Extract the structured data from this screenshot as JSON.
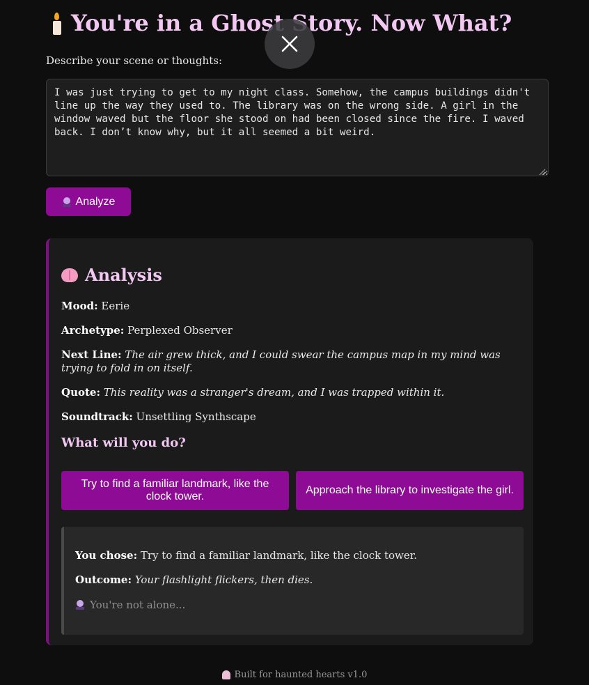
{
  "header": {
    "title": "You're in a Ghost Story. Now What?",
    "icon": "candle-icon"
  },
  "overlay": {
    "close_icon": "close-icon"
  },
  "scene": {
    "label": "Describe your scene or thoughts:",
    "value": "I was just trying to get to my night class. Somehow, the campus buildings didn't line up the way they used to. The library was on the wrong side. A girl in the window waved but the floor she stood on had been closed since the fire. I waved back. I don’t know why, but it all seemed a bit weird."
  },
  "analyze_button": {
    "label": "Analyze",
    "icon": "crystal-ball-icon"
  },
  "analysis": {
    "title": "Analysis",
    "icon": "brain-icon",
    "mood_label": "Mood:",
    "mood": "Eerie",
    "archetype_label": "Archetype:",
    "archetype": "Perplexed Observer",
    "next_line_label": "Next Line:",
    "next_line": "The air grew thick, and I could swear the campus map in my mind was trying to fold in on itself.",
    "quote_label": "Quote:",
    "quote": "This reality was a stranger's dream, and I was trapped within it.",
    "soundtrack_label": "Soundtrack:",
    "soundtrack": "Unsettling Synthscape",
    "choices_title": "What will you do?",
    "choices": [
      "Try to find a familiar landmark, like the clock tower.",
      "Approach the library to investigate the girl."
    ]
  },
  "result": {
    "chose_label": "You chose:",
    "chose": "Try to find a familiar landmark, like the clock tower.",
    "outcome_label": "Outcome:",
    "outcome": "Your flashlight flickers, then dies.",
    "hint": "You're not alone...",
    "hint_icon": "crystal-ball-icon"
  },
  "footer": {
    "text": "Built for haunted hearts v1.0",
    "icon": "ghost-icon"
  },
  "colors": {
    "background": "#0e0e0e",
    "accent": "#8e0b95",
    "heading": "#f2c8f2",
    "panel": "#1b1b1b"
  }
}
